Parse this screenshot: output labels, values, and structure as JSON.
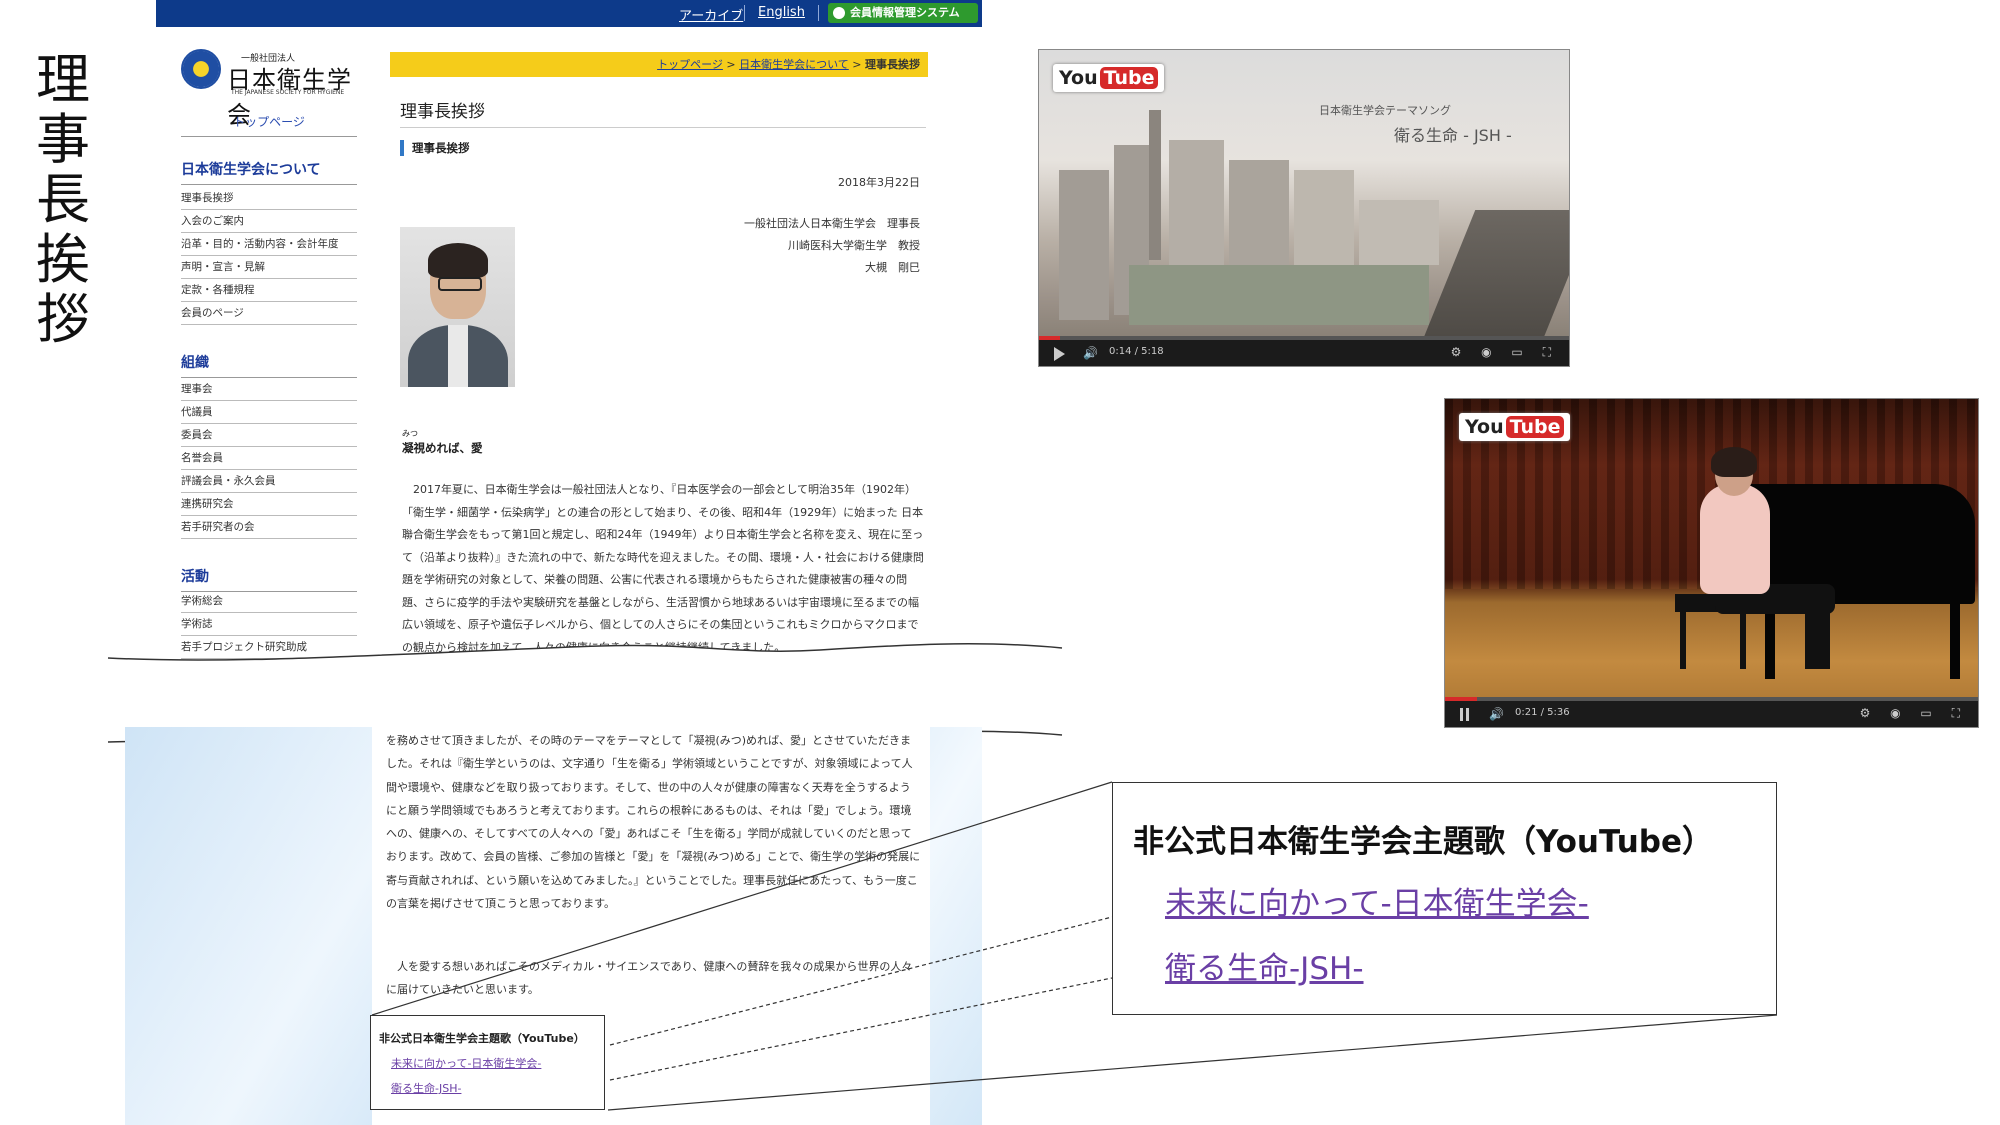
{
  "slide": {
    "title_chars": [
      "理",
      "事",
      "長",
      "挨",
      "拶"
    ]
  },
  "site": {
    "topbar": {
      "archive": "アーカイブ",
      "english": "English",
      "login": "会員情報管理システムLOGIN"
    },
    "logo": {
      "small": "一般社団法人",
      "name": "日本衛生学会",
      "english": "THE JAPANESE SOCIETY FOR HYGIENE"
    },
    "sidebar": {
      "top_link": "トップページ",
      "section_about": "日本衛生学会について",
      "about_items": [
        "理事長挨拶",
        "入会のご案内",
        "沿革・目的・活動内容・会計年度",
        "声明・宣言・見解",
        "定款・各種規程",
        "会員のページ"
      ],
      "section_org": "組織",
      "org_items": [
        "理事会",
        "代議員",
        "委員会",
        "名誉会員",
        "評議会員・永久会員",
        "連携研究会",
        "若手研究者の会"
      ],
      "section_activity": "活動",
      "activity_items": [
        "学術総会",
        "学術誌",
        "若手プロジェクト研究助成"
      ]
    },
    "breadcrumb": {
      "home": "トップページ",
      "sep": " > ",
      "about": "日本衛生学会について",
      "current": "理事長挨拶"
    },
    "page_title": "理事長挨拶",
    "subheading": "理事長挨拶",
    "date": "2018年3月22日",
    "signature": [
      "一般社団法人日本衛生学会　理事長",
      "川崎医科大学衛生学　教授",
      "大槻　剛巳"
    ],
    "motto_ruby": "みつ",
    "motto": "凝視めれば、愛",
    "paragraph1": "2017年夏に、日本衛生学会は一般社団法人となり、『日本医学会の一部会として明治35年（1902年）「衛生学・細菌学・伝染病学」との連合の形として始まり、その後、昭和4年（1929年）に始まった 日本聯合衛生学会をもって第1回と規定し、昭和24年（1949年）より日本衛生学会と名称を変え、現在に至って（沿革より抜粋）』きた流れの中で、新たな時代を迎えました。その間、環境・人・社会における健康問題を学術研究の対象として、栄養の問題、公害に代表される環境からもたらされた健康被害の種々の問題、さらに疫学的手法や実験研究を基盤としながら、生活習慣から地球あるいは宇宙環境に至るまでの幅広い領域を、原子や遺伝子レベルから、個としての人さらにその集団というこれもミクロからマクロまでの観点から検討を加えて、人々の健康に向き合うこと継持継続してきました。",
    "paragraph2": "を務めさせて頂きましたが、その時のテーマをテーマとして「凝視(みつ)めれば、愛」とさせていただきました。それは『衛生学というのは、文字通り「生を衛る」学術領域ということですが、対象領域によって人間や環境や、健康などを取り扱っております。そして、世の中の人々が健康の障害なく天寿を全うするようにと願う学問領域でもあろうと考えております。これらの根幹にあるものは、それは「愛」でしょう。環境への、健康への、そしてすべての人々への「愛」あればこそ「生を衛る」学問が成就していくのだと思っております。改めて、会員の皆様、ご参加の皆様と「愛」を「凝視(みつ)める」ことで、衛生学の学術の発展に寄与貢献されれば、という願いを込めてみました。』ということでした。理事長就任にあたって、もう一度この言葉を掲げさせて頂こうと思っております。",
    "paragraph3": "人を愛する想いあればこそのメディカル・サイエンスであり、健康への賛辞を我々の成果から世界の人々に届けていきたいと思います。",
    "song_box": {
      "title": "非公式日本衛生学会主題歌（YouTube）",
      "link1": "未来に向かって-日本衛生学会-",
      "link2": "衛る生命-JSH-"
    }
  },
  "callout": {
    "title": "非公式日本衛生学会主題歌（YouTube）",
    "link1": "未来に向かって-日本衛生学会-",
    "link2": "衛る生命-JSH-"
  },
  "videos": [
    {
      "logo_you": "You",
      "logo_tube": "Tube",
      "overlay_line1": "日本衛生学会テーマソング",
      "overlay_line2": "衛る生命 - JSH -",
      "time": "0:14 / 5:18",
      "progress": 0.04
    },
    {
      "logo_you": "You",
      "logo_tube": "Tube",
      "time": "0:21 / 5:36",
      "progress": 0.06
    }
  ]
}
